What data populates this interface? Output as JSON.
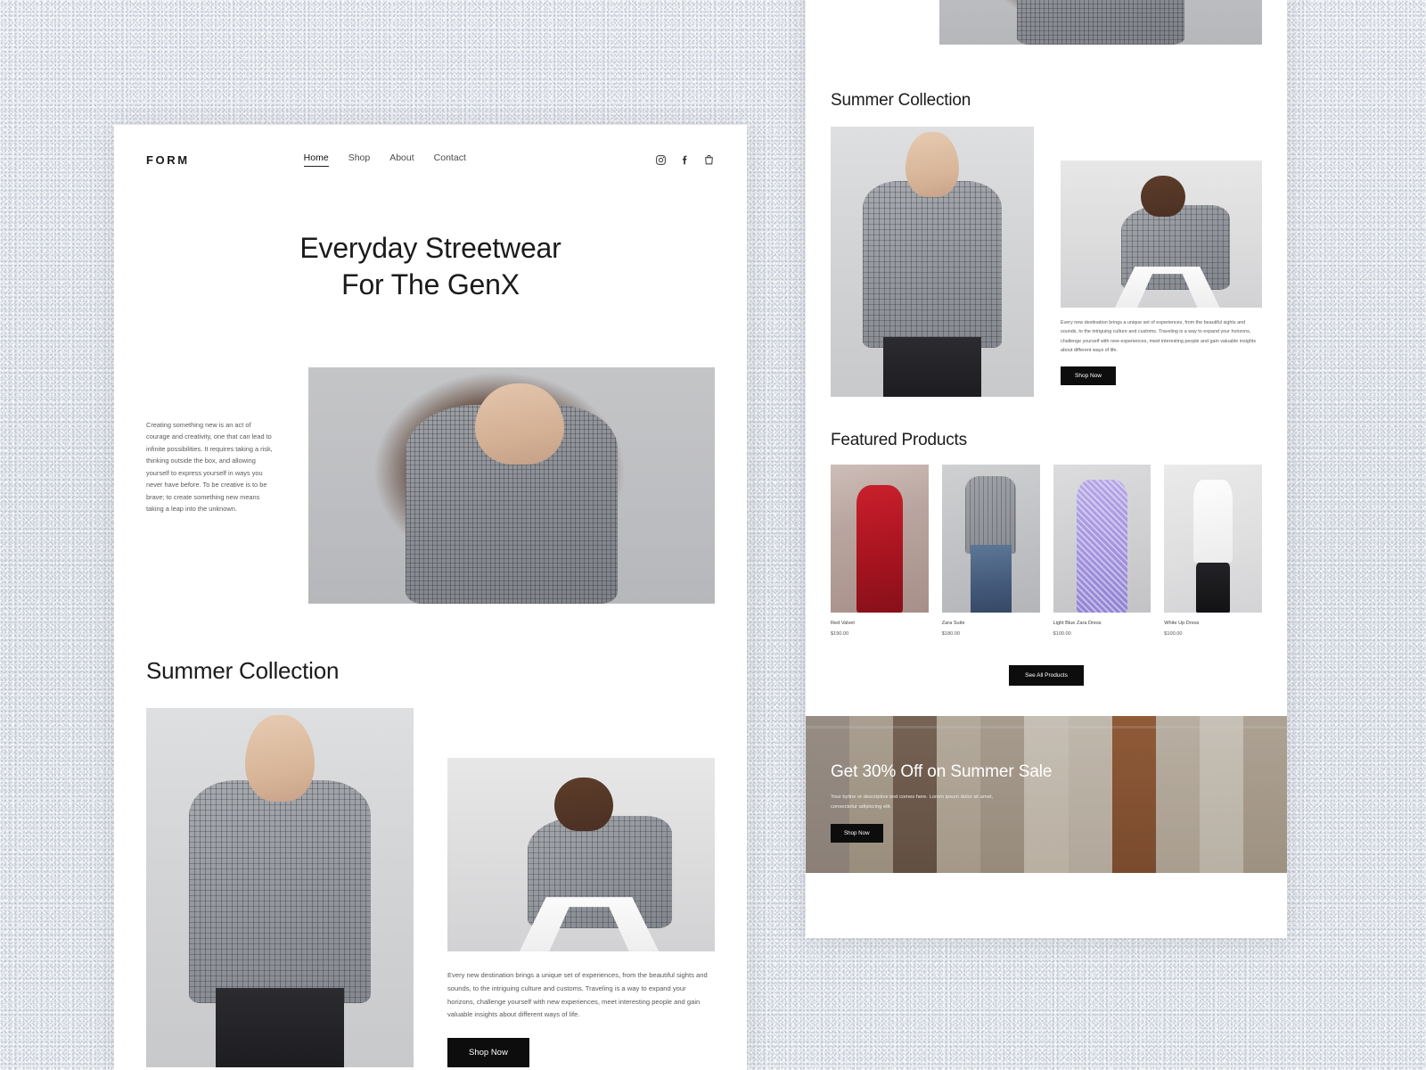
{
  "site": {
    "logo": "FORM",
    "nav": [
      {
        "label": "Home",
        "active": true
      },
      {
        "label": "Shop",
        "active": false
      },
      {
        "label": "About",
        "active": false
      },
      {
        "label": "Contact",
        "active": false
      }
    ],
    "icons": [
      "instagram-icon",
      "facebook-icon",
      "shopping-bag-icon"
    ]
  },
  "hero": {
    "line1": "Everyday Streetwear",
    "line2": "For The GenX"
  },
  "intro": {
    "paragraph": "Creating something new is an act of courage and creativity, one that can lead to infinite possibilities. It requires taking a risk, thinking outside the box, and allowing yourself to express yourself in ways you never have before. To be creative is to be brave; to create something new means taking a leap into the unknown.",
    "paragraph_tail": "yourself to express yourself in ways you never have before. To be creative is to be brave; to create something new means taking a leap into the unknown."
  },
  "collection": {
    "title": "Summer Collection",
    "paragraph": "Every new destination brings a unique set of experiences, from the beautiful sights and sounds, to the intriguing culture and customs. Traveling is a way to expand your horizons, challenge yourself with new experiences, meet interesting people and gain valuable insights about different ways of life.",
    "cta": "Shop Now"
  },
  "featured": {
    "title": "Featured Products",
    "see_all": "See All Products",
    "products": [
      {
        "name": "Red Valvet",
        "price": "$190.00",
        "swatch": "ph-prod-red"
      },
      {
        "name": "Zara Suite",
        "price": "$180.00",
        "swatch": "ph-prod-jean"
      },
      {
        "name": "Light Blue Zara Dress",
        "price": "$100.00",
        "swatch": "ph-prod-lilac"
      },
      {
        "name": "White Up Dress",
        "price": "$100.00",
        "swatch": "ph-prod-white"
      }
    ]
  },
  "promo": {
    "heading": "Get 30% Off on Summer Sale",
    "byline": "Your byline or descriptive text comes here. Lorem ipsum dolor sit amet, consectetur adipiscing elit.",
    "cta": "Shop Now"
  },
  "colors": {
    "accent": "#0d0d0d",
    "page_background": "#e9ebef",
    "panel": "#ffffff",
    "text": "#1b1b1b",
    "muted_text": "#585858",
    "promo_background": "#98897f"
  }
}
